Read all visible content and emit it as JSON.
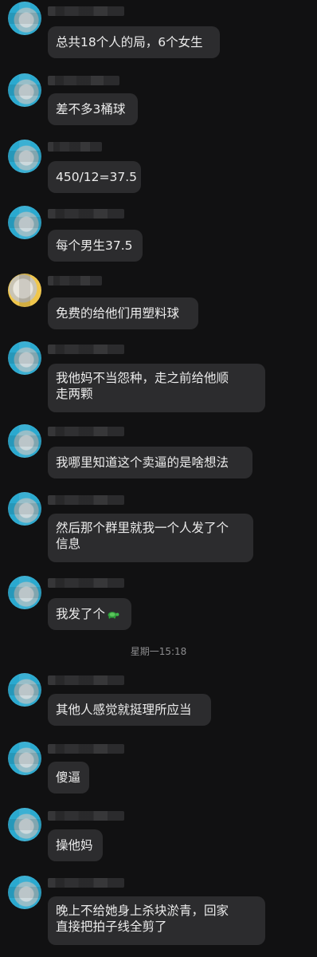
{
  "chat": {
    "messages": [
      {
        "text": "总共18个人的局，6个女生"
      },
      {
        "text": "差不多3桶球"
      },
      {
        "text": "450/12=37.5"
      },
      {
        "text": "每个男生37.5"
      },
      {
        "text": "免费的给他们用塑料球"
      },
      {
        "text_line1": "我他妈不当怨种，走之前给他顺",
        "text_line2": "走两颗"
      },
      {
        "text": "我哪里知道这个卖逼的是啥想法"
      },
      {
        "text_line1": "然后那个群里就我一个人发了个",
        "text_line2": "信息"
      },
      {
        "text": "我发了个",
        "emoji": "turtle-emoji"
      },
      {
        "text": "其他人感觉就挺理所应当"
      },
      {
        "text": "傻逼"
      },
      {
        "text": "操他妈"
      },
      {
        "text_line1": "晚上不给她身上杀块淤青，回家",
        "text_line2": "直接把拍子线全剪了"
      }
    ],
    "timestamp": "星期一15:18"
  },
  "colors": {
    "background": "#111112",
    "bubble": "#2c2c2e",
    "text": "#ececec",
    "timestamp": "#8c8c8e"
  }
}
